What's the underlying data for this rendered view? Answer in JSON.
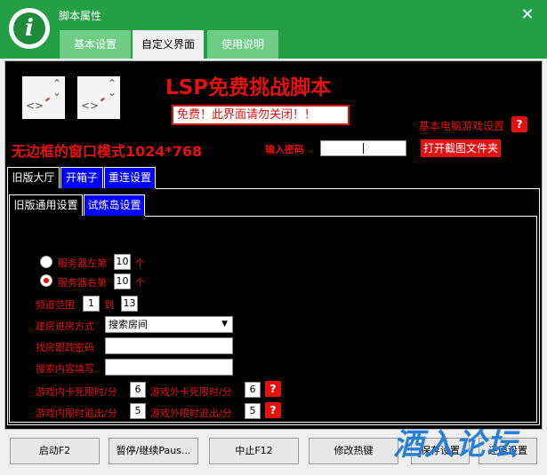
{
  "window": {
    "title": "脚本属性",
    "close_glyph": "✕",
    "app_icon_glyph": "i",
    "tabs": [
      {
        "label": "基本设置",
        "active": false
      },
      {
        "label": "自定义界面",
        "active": true
      },
      {
        "label": "使用说明",
        "active": false
      }
    ],
    "colors": {
      "titlebar": "#23a046",
      "tab_inactive": "#6fcc85",
      "accent_red": "#e51010",
      "panel_bg": "#000000",
      "tab_blue": "#0000ff"
    }
  },
  "header": {
    "thumb_chevron": "⌃\n⌄",
    "thumb_code": "<>",
    "script_title": "LSP免费挑战脚本",
    "notice": "免费！此界面请勿关闭！！",
    "basic_game_settings": "基本电脑游戏设置",
    "help_glyph": "?",
    "window_mode": "无边框的窗口模式1024*768",
    "password_label": "输入密码",
    "password_value": "",
    "open_screenshot_folder": "打开截图文件夹"
  },
  "outer_tabs": [
    {
      "label": "旧版大厅",
      "active": true
    },
    {
      "label": "开箱子",
      "active": false
    },
    {
      "label": "重连设置",
      "active": false
    }
  ],
  "inner_tabs": [
    {
      "label": "旧版通用设置",
      "active": true
    },
    {
      "label": "试炼岛设置",
      "active": false
    }
  ],
  "settings": {
    "server_left_label": "服务器左第",
    "server_left_value": "10",
    "server_left_unit": "个",
    "server_left_checked": false,
    "server_right_label": "服务器右第",
    "server_right_value": "10",
    "server_right_unit": "个",
    "server_right_checked": true,
    "channel_range_label": "频道范围",
    "channel_from": "1",
    "channel_to_label": "到",
    "channel_to": "13",
    "room_mode_label": "建房进房方式",
    "room_mode_value": "搜索房间",
    "dropdown_glyph": "▼",
    "track_password_label": "找房跟踪密码",
    "track_password_value": "",
    "search_content_label": "搜索内容填写",
    "search_content_value": "",
    "in_game_stuck_label": "游戏内卡死限时/分",
    "in_game_stuck_value": "6",
    "out_game_stuck_label": "游戏外卡死限时/分",
    "out_game_stuck_value": "6",
    "in_game_exit_label": "游戏内限时退出/分",
    "in_game_exit_value": "5",
    "out_game_exit_label": "游戏外限时退出/分",
    "out_game_exit_value": "5"
  },
  "buttons": {
    "start": "启动F2",
    "pause": "暂停/继续Paus...",
    "stop": "中止F12",
    "hotkey": "修改热键",
    "save": "保存设置",
    "restore": "还原设置"
  },
  "watermark": "酒入论坛"
}
